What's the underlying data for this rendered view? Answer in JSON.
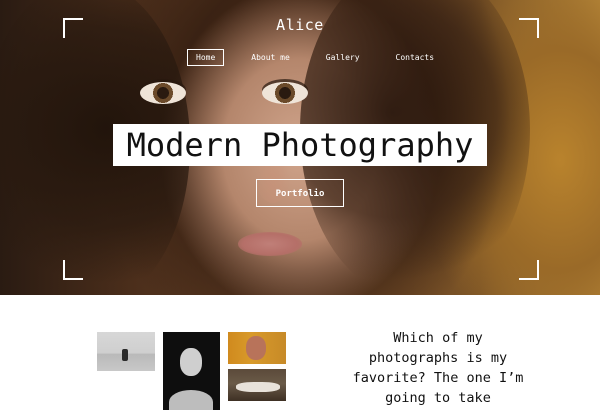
{
  "brand": "Alice",
  "nav": [
    {
      "label": "Home",
      "active": true
    },
    {
      "label": "About me",
      "active": false
    },
    {
      "label": "Gallery",
      "active": false
    },
    {
      "label": "Contacts",
      "active": false
    }
  ],
  "hero": {
    "headline": "Modern Photography",
    "cta_label": "Portfolio"
  },
  "quote": {
    "lines": [
      "Which of my",
      "photographs is my",
      "favorite? The one I’m",
      "going to take"
    ]
  },
  "colors": {
    "hero_overlay": "#ffffff",
    "text_dark": "#111111",
    "background": "#ffffff"
  }
}
